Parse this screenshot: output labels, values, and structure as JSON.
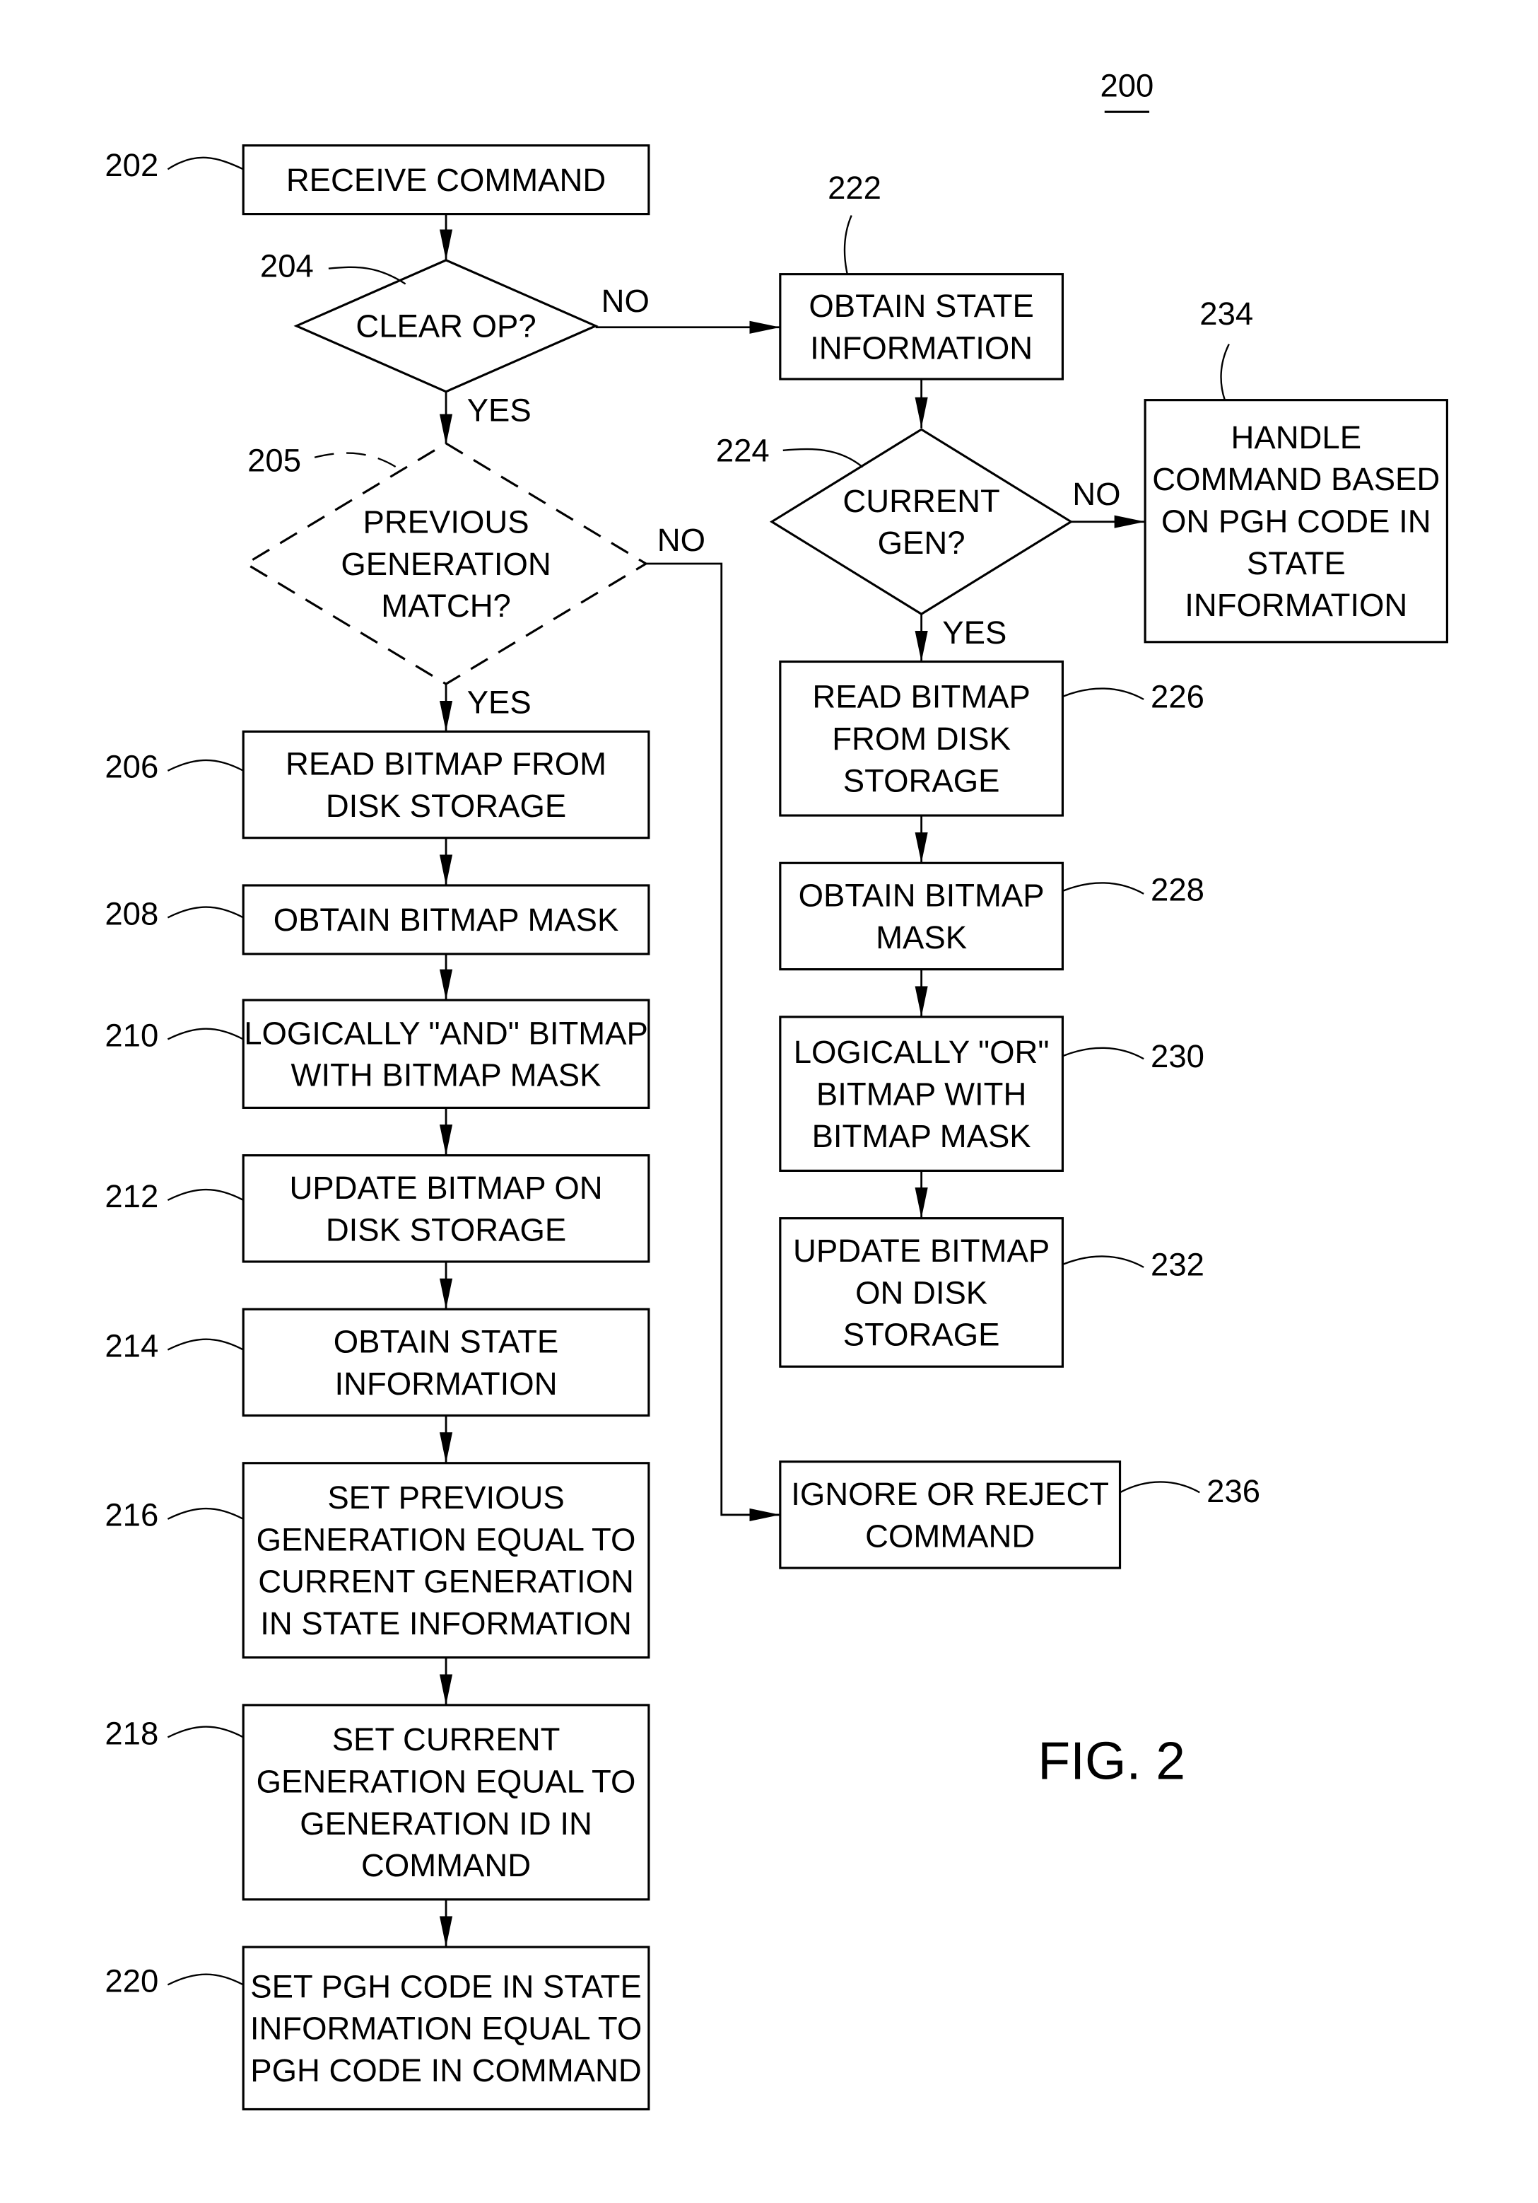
{
  "figure": {
    "number_ref": "200",
    "caption": "FIG. 2"
  },
  "nodes": {
    "n202": {
      "ref": "202",
      "lines": [
        "RECEIVE COMMAND"
      ]
    },
    "n204": {
      "ref": "204",
      "lines": [
        "CLEAR OP?"
      ]
    },
    "n205": {
      "ref": "205",
      "lines": [
        "PREVIOUS",
        "GENERATION",
        "MATCH?"
      ]
    },
    "n206": {
      "ref": "206",
      "lines": [
        "READ BITMAP FROM",
        "DISK STORAGE"
      ]
    },
    "n208": {
      "ref": "208",
      "lines": [
        "OBTAIN BITMAP MASK"
      ]
    },
    "n210": {
      "ref": "210",
      "lines": [
        "LOGICALLY \"AND\" BITMAP",
        "WITH BITMAP MASK"
      ]
    },
    "n212": {
      "ref": "212",
      "lines": [
        "UPDATE BITMAP ON",
        "DISK STORAGE"
      ]
    },
    "n214": {
      "ref": "214",
      "lines": [
        "OBTAIN STATE",
        "INFORMATION"
      ]
    },
    "n216": {
      "ref": "216",
      "lines": [
        "SET PREVIOUS",
        "GENERATION EQUAL TO",
        "CURRENT GENERATION",
        "IN STATE INFORMATION"
      ]
    },
    "n218": {
      "ref": "218",
      "lines": [
        "SET CURRENT",
        "GENERATION EQUAL TO",
        "GENERATION ID IN",
        "COMMAND"
      ]
    },
    "n220": {
      "ref": "220",
      "lines": [
        "SET PGH CODE IN STATE",
        "INFORMATION EQUAL TO",
        "PGH CODE IN COMMAND"
      ]
    },
    "n222": {
      "ref": "222",
      "lines": [
        "OBTAIN STATE",
        "INFORMATION"
      ]
    },
    "n224": {
      "ref": "224",
      "lines": [
        "CURRENT",
        "GEN?"
      ]
    },
    "n226": {
      "ref": "226",
      "lines": [
        "READ BITMAP",
        "FROM DISK",
        "STORAGE"
      ]
    },
    "n228": {
      "ref": "228",
      "lines": [
        "OBTAIN BITMAP",
        "MASK"
      ]
    },
    "n230": {
      "ref": "230",
      "lines": [
        "LOGICALLY \"OR\"",
        "BITMAP WITH",
        "BITMAP MASK"
      ]
    },
    "n232": {
      "ref": "232",
      "lines": [
        "UPDATE BITMAP",
        "ON DISK",
        "STORAGE"
      ]
    },
    "n234": {
      "ref": "234",
      "lines": [
        "HANDLE",
        "COMMAND BASED",
        "ON PGH CODE IN",
        "STATE",
        "INFORMATION"
      ]
    },
    "n236": {
      "ref": "236",
      "lines": [
        "IGNORE OR REJECT",
        "COMMAND"
      ]
    }
  },
  "edge_labels": {
    "e204_no": "NO",
    "e204_yes": "YES",
    "e205_no": "NO",
    "e205_yes": "YES",
    "e224_no": "NO",
    "e224_yes": "YES"
  }
}
